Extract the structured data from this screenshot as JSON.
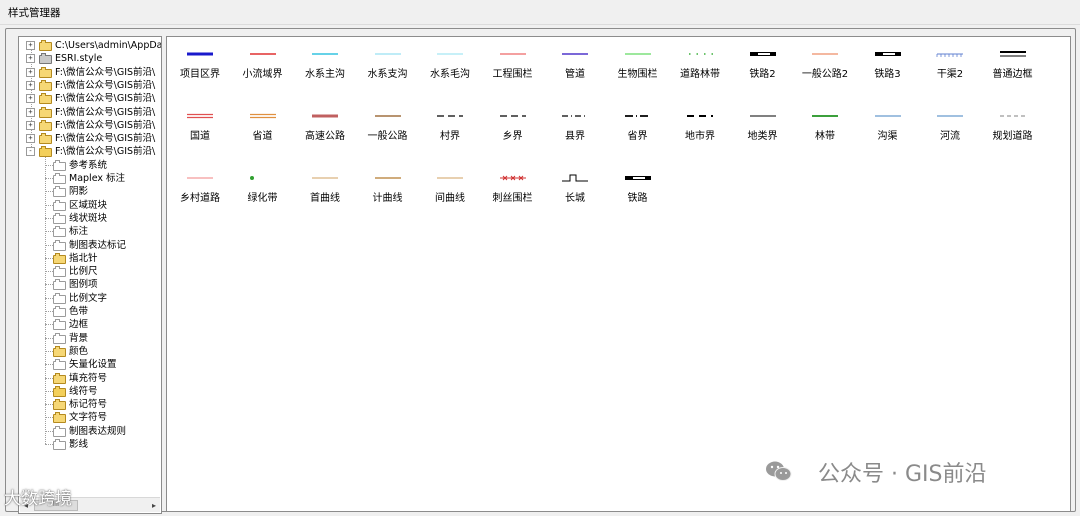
{
  "window": {
    "title": "样式管理器"
  },
  "tree": {
    "nodes": [
      {
        "label": "C:\\Users\\admin\\AppData\\",
        "level": 0,
        "expander": "+",
        "folder": "closed"
      },
      {
        "label": "ESRI.style",
        "level": 0,
        "expander": "+",
        "folder": "gray"
      },
      {
        "label": "F:\\微信公众号\\GIS前沿\\",
        "level": 0,
        "expander": "+",
        "folder": "closed"
      },
      {
        "label": "F:\\微信公众号\\GIS前沿\\",
        "level": 0,
        "expander": "+",
        "folder": "closed"
      },
      {
        "label": "F:\\微信公众号\\GIS前沿\\",
        "level": 0,
        "expander": "+",
        "folder": "closed"
      },
      {
        "label": "F:\\微信公众号\\GIS前沿\\",
        "level": 0,
        "expander": "+",
        "folder": "closed"
      },
      {
        "label": "F:\\微信公众号\\GIS前沿\\",
        "level": 0,
        "expander": "+",
        "folder": "closed"
      },
      {
        "label": "F:\\微信公众号\\GIS前沿\\",
        "level": 0,
        "expander": "+",
        "folder": "closed"
      },
      {
        "label": "F:\\微信公众号\\GIS前沿\\",
        "level": 0,
        "expander": "-",
        "folder": "open"
      },
      {
        "label": "参考系统",
        "level": 1,
        "folder": "empty"
      },
      {
        "label": "Maplex 标注",
        "level": 1,
        "folder": "empty"
      },
      {
        "label": "阴影",
        "level": 1,
        "folder": "empty"
      },
      {
        "label": "区域斑块",
        "level": 1,
        "folder": "empty"
      },
      {
        "label": "线状斑块",
        "level": 1,
        "folder": "empty"
      },
      {
        "label": "标注",
        "level": 1,
        "folder": "empty"
      },
      {
        "label": "制图表达标记",
        "level": 1,
        "folder": "empty"
      },
      {
        "label": "指北针",
        "level": 1,
        "folder": "closed"
      },
      {
        "label": "比例尺",
        "level": 1,
        "folder": "empty"
      },
      {
        "label": "图例项",
        "level": 1,
        "folder": "empty"
      },
      {
        "label": "比例文字",
        "level": 1,
        "folder": "empty"
      },
      {
        "label": "色带",
        "level": 1,
        "folder": "empty"
      },
      {
        "label": "边框",
        "level": 1,
        "folder": "empty"
      },
      {
        "label": "背景",
        "level": 1,
        "folder": "empty"
      },
      {
        "label": "颜色",
        "level": 1,
        "folder": "closed"
      },
      {
        "label": "矢量化设置",
        "level": 1,
        "folder": "empty"
      },
      {
        "label": "填充符号",
        "level": 1,
        "folder": "closed"
      },
      {
        "label": "线符号",
        "level": 1,
        "folder": "open"
      },
      {
        "label": "标记符号",
        "level": 1,
        "folder": "closed"
      },
      {
        "label": "文字符号",
        "level": 1,
        "folder": "closed"
      },
      {
        "label": "制图表达规则",
        "level": 1,
        "folder": "empty"
      },
      {
        "label": "影线",
        "level": 1,
        "folder": "empty"
      }
    ],
    "scroll_thumb": "III"
  },
  "symbols": [
    {
      "label": "项目区界",
      "color": "#1a1acc",
      "style": "thick"
    },
    {
      "label": "小流域界",
      "color": "#e03030",
      "style": "solid"
    },
    {
      "label": "水系主沟",
      "color": "#33c3e0",
      "style": "solid"
    },
    {
      "label": "水系支沟",
      "color": "#7fd8ef",
      "style": "thin"
    },
    {
      "label": "水系毛沟",
      "color": "#8fe0f0",
      "style": "thin"
    },
    {
      "label": "工程围栏",
      "color": "#f08080",
      "style": "solid"
    },
    {
      "label": "管道",
      "color": "#7b68d8",
      "style": "medium"
    },
    {
      "label": "生物围栏",
      "color": "#7de07d",
      "style": "solid"
    },
    {
      "label": "道路林带",
      "color": "#3cb03c",
      "style": "dots"
    },
    {
      "label": "铁路2",
      "color": "#000000",
      "style": "rail"
    },
    {
      "label": "一般公路2",
      "color": "#f0a080",
      "style": "solid"
    },
    {
      "label": "铁路3",
      "color": "#000000",
      "style": "rail"
    },
    {
      "label": "干渠2",
      "color": "#6080d0",
      "style": "ticks"
    },
    {
      "label": "普通边框",
      "color": "#000000",
      "style": "double"
    },
    {
      "label": "国道",
      "color": "#e05050",
      "style": "double-color"
    },
    {
      "label": "省道",
      "color": "#e09040",
      "style": "double-color"
    },
    {
      "label": "高速公路",
      "color": "#c06060",
      "style": "thick"
    },
    {
      "label": "一般公路",
      "color": "#a07040",
      "style": "solid"
    },
    {
      "label": "村界",
      "color": "#000000",
      "style": "dash-long"
    },
    {
      "label": "乡界",
      "color": "#000000",
      "style": "dash-long"
    },
    {
      "label": "县界",
      "color": "#000000",
      "style": "dash-dot"
    },
    {
      "label": "省界",
      "color": "#000000",
      "style": "dash-dot-thick"
    },
    {
      "label": "地市界",
      "color": "#000000",
      "style": "dash-thick"
    },
    {
      "label": "地类界",
      "color": "#000000",
      "style": "thin"
    },
    {
      "label": "林带",
      "color": "#3ca03c",
      "style": "medium"
    },
    {
      "label": "沟渠",
      "color": "#4080c0",
      "style": "thin"
    },
    {
      "label": "河流",
      "color": "#4080c0",
      "style": "thin"
    },
    {
      "label": "规划道路",
      "color": "#808080",
      "style": "dash-small"
    },
    {
      "label": "乡村道路",
      "color": "#f08080",
      "style": "thin"
    },
    {
      "label": "绿化带",
      "color": "#30a030",
      "style": "dot"
    },
    {
      "label": "首曲线",
      "color": "#d0a060",
      "style": "thin"
    },
    {
      "label": "计曲线",
      "color": "#c09050",
      "style": "solid"
    },
    {
      "label": "间曲线",
      "color": "#d0a060",
      "style": "thin"
    },
    {
      "label": "刺丝围栏",
      "color": "#d03030",
      "style": "barbed"
    },
    {
      "label": "长城",
      "color": "#000000",
      "style": "wall"
    },
    {
      "label": "铁路",
      "color": "#000000",
      "style": "rail"
    }
  ],
  "watermark": {
    "text": "公众号 · GIS前沿"
  },
  "badge": {
    "text": "大数跨境"
  }
}
